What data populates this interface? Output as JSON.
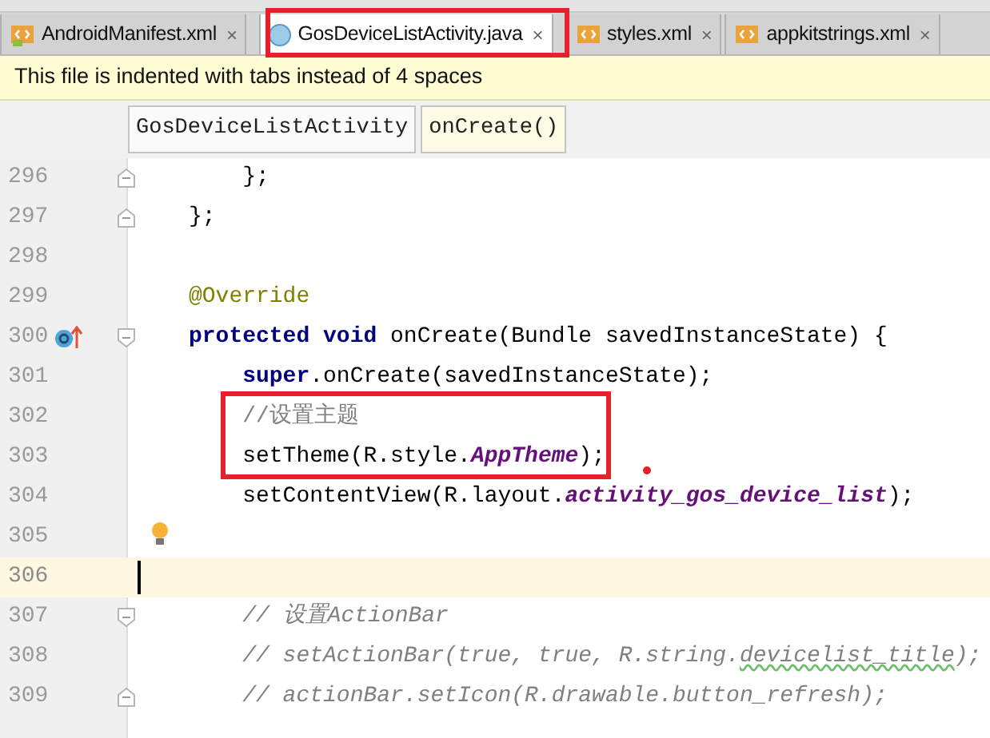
{
  "tabs": [
    {
      "label": "AndroidManifest.xml",
      "kind": "manifest",
      "selected": false,
      "close": "×"
    },
    {
      "label": "GosDeviceListActivity.java",
      "kind": "class",
      "selected": true,
      "close": "×"
    },
    {
      "label": "styles.xml",
      "kind": "xml",
      "selected": false,
      "close": "×"
    },
    {
      "label": "appkitstrings.xml",
      "kind": "xml",
      "selected": false,
      "close": "×"
    }
  ],
  "notice": "This file is indented with tabs instead of 4 spaces",
  "breadcrumbs": [
    {
      "label": "GosDeviceListActivity",
      "selected": false
    },
    {
      "label": "onCreate()",
      "selected": true
    }
  ],
  "lines": [
    {
      "number": "296",
      "gutter": [
        {
          "kind": "fold_end"
        }
      ],
      "current": false,
      "tokens": [
        {
          "text": "    };",
          "kind": "plain"
        }
      ]
    },
    {
      "number": "297",
      "gutter": [
        {
          "kind": "fold_end"
        }
      ],
      "current": false,
      "tokens": [
        {
          "text": "};",
          "kind": "plain"
        }
      ]
    },
    {
      "number": "298",
      "current": false
    },
    {
      "number": "299",
      "current": false,
      "tokens": [
        {
          "text": "@Override",
          "kind": "annotation"
        }
      ]
    },
    {
      "number": "300",
      "gutter": [
        {
          "kind": "override"
        },
        {
          "kind": "fold_start"
        }
      ],
      "current": false,
      "tokens": [
        {
          "text": "protected void",
          "kind": "keyword"
        },
        {
          "text": " onCreate(Bundle savedInstanceState) {",
          "kind": "plain"
        }
      ]
    },
    {
      "number": "301",
      "current": false,
      "tokens": [
        {
          "text": "    super",
          "kind": "keyword"
        },
        {
          "text": ".onCreate(savedInstanceState);",
          "kind": "plain"
        }
      ]
    },
    {
      "number": "302",
      "current": false,
      "tokens": [
        {
          "text": "    //设置主题",
          "kind": "comment"
        }
      ]
    },
    {
      "number": "303",
      "current": false,
      "tokens": [
        {
          "text": "    setTheme(R.style.",
          "kind": "plain"
        },
        {
          "text": "AppTheme",
          "kind": "field"
        },
        {
          "text": ");",
          "kind": "plain"
        }
      ]
    },
    {
      "number": "304",
      "current": false,
      "tokens": [
        {
          "text": "    setContentView(R.layout.",
          "kind": "plain"
        },
        {
          "text": "activity_gos_device_list",
          "kind": "field"
        },
        {
          "text": ");",
          "kind": "plain"
        }
      ]
    },
    {
      "number": "305",
      "gutter": [
        {
          "kind": "bulb"
        }
      ],
      "current": false
    },
    {
      "number": "306",
      "current": true
    },
    {
      "number": "307",
      "gutter": [
        {
          "kind": "fold_start"
        }
      ],
      "current": false,
      "tokens": [
        {
          "text": "    // 设置ActionBar",
          "kind": "doc"
        }
      ]
    },
    {
      "number": "308",
      "current": false,
      "tokens": [
        {
          "text": "    // setActionBar(true, true, R.string.",
          "kind": "doc"
        },
        {
          "text": "devicelist_title",
          "kind": "typo"
        },
        {
          "text": ");",
          "kind": "doc"
        }
      ]
    },
    {
      "number": "309",
      "gutter": [
        {
          "kind": "fold_end"
        }
      ],
      "current": false,
      "tokens": [
        {
          "text": "    // actionBar.setIcon(R.drawable.button_refresh);",
          "kind": "doc"
        }
      ]
    }
  ]
}
